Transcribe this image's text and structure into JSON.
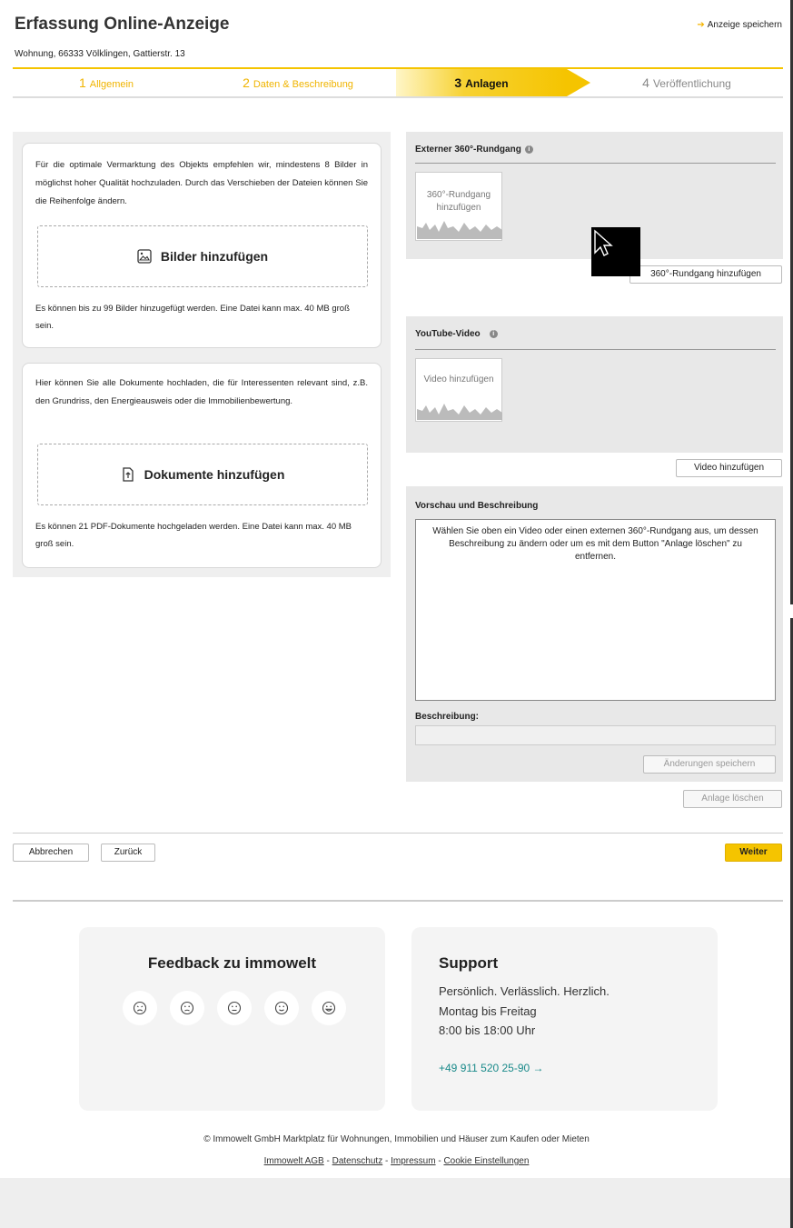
{
  "header": {
    "title": "Erfassung Online-Anzeige",
    "save_link": "Anzeige speichern",
    "address": "Wohnung, 66333 Völklingen, Gattierstr. 13"
  },
  "steps": [
    {
      "num": "1",
      "label": "Allgemein",
      "state": "done"
    },
    {
      "num": "2",
      "label": "Daten & Beschreibung",
      "state": "done"
    },
    {
      "num": "3",
      "label": "Anlagen",
      "state": "active"
    },
    {
      "num": "4",
      "label": "Veröffentlichung",
      "state": "future"
    }
  ],
  "images_card": {
    "description": "Für die optimale Vermarktung des Objekts empfehlen wir, mindestens 8 Bilder in möglichst hoher Qualität hochzuladen. Durch das Verschieben der Dateien können Sie die Reihenfolge ändern.",
    "button": "Bilder hinzufügen",
    "note": "Es können bis zu 99 Bilder hinzugefügt werden. Eine Datei kann max. 40 MB groß sein."
  },
  "documents_card": {
    "description": "Hier können Sie alle Dokumente hochladen, die für Interessenten relevant sind, z.B. den Grundriss, den Energieausweis oder die Immobilienbewertung.",
    "button": "Dokumente hinzufügen",
    "note": "Es können 21 PDF-Dokumente hochgeladen werden. Eine Datei kann max. 40 MB groß sein."
  },
  "tour_box": {
    "title": "Externer 360°-Rundgang",
    "thumb_label": "360°-Rundgang hinzufügen",
    "button": "360°-Rundgang hinzufügen"
  },
  "video_box": {
    "title": "YouTube-Video",
    "thumb_label": "Video hinzufügen",
    "button": "Video hinzufügen"
  },
  "preview_box": {
    "title": "Vorschau und Beschreibung",
    "text": "Wählen Sie oben ein Video oder einen externen 360°-Rundgang aus, um dessen Beschreibung zu ändern oder um es mit dem Button \"Anlage löschen\" zu entfernen.",
    "desc_label": "Beschreibung:",
    "save_button": "Änderungen speichern",
    "delete_button": "Anlage löschen"
  },
  "nav": {
    "cancel": "Abbrechen",
    "back": "Zurück",
    "next": "Weiter"
  },
  "feedback": {
    "title": "Feedback zu immowelt",
    "smileys": [
      "very-unhappy",
      "unhappy",
      "neutral",
      "happy",
      "very-happy"
    ]
  },
  "support": {
    "title": "Support",
    "line1": "Persönlich. Verlässlich. Herzlich.",
    "line2": "Montag bis Freitag",
    "line3": "8:00 bis 18:00 Uhr",
    "phone": "+49 911 520 25-90 →"
  },
  "footer": {
    "copyright": "© Immowelt GmbH Marktplatz für Wohnungen, Immobilien und Häuser zum Kaufen oder Mieten",
    "links": [
      "Immowelt AGB",
      "Datenschutz",
      "Impressum",
      "Cookie Einstellungen"
    ]
  },
  "colors": {
    "accent": "#f5c400",
    "step_done": "#f0b400",
    "phone_link": "#1a8a8a"
  }
}
